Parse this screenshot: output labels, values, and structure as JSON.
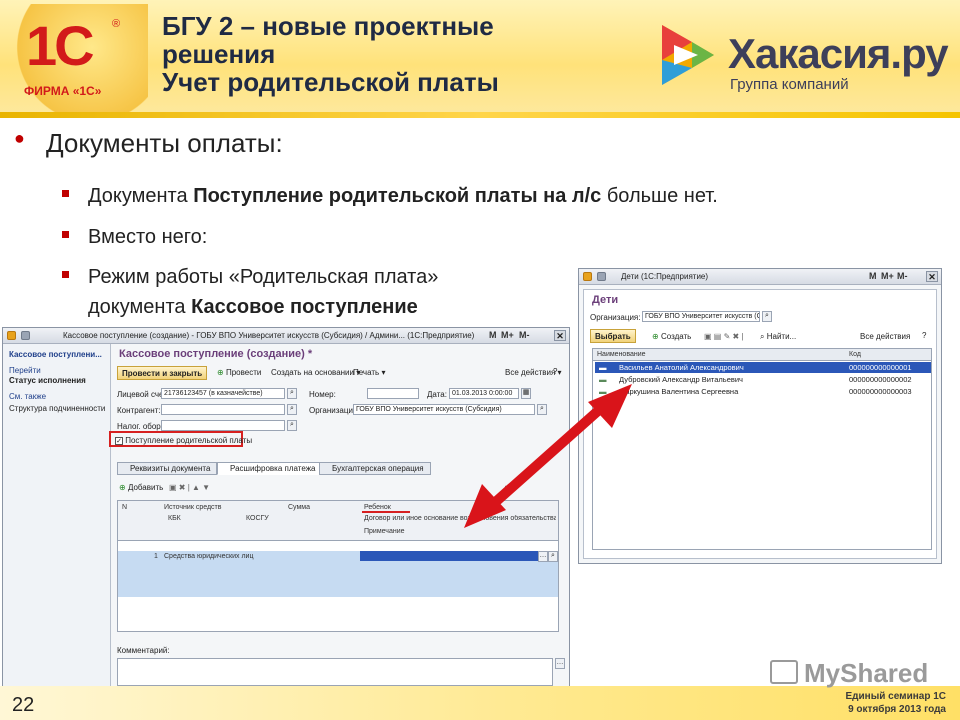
{
  "slide": {
    "title_lines": [
      "БГУ 2 – новые проектные",
      "решения",
      "Учет родительской платы"
    ],
    "logo_1c": {
      "mark": "1С",
      "reg": "®",
      "text": "ФИРМА «1С»"
    },
    "partner_logo": {
      "name": "Хакасия.ру",
      "subtitle": "Группа компаний"
    },
    "main_bullet": "Документы оплаты:",
    "sub_bullets": [
      {
        "before": "Документа ",
        "bold": "Поступление родительской платы на л/с",
        "after": " больше нет."
      },
      {
        "before": "Вместо него:",
        "bold": "",
        "after": ""
      },
      {
        "line1": "Режим работы «Родительская плата»",
        "line2_before": "документа ",
        "line2_bold": "Кассовое поступление"
      }
    ],
    "page_number": "22",
    "footer_line1": "Единый семинар 1С",
    "footer_line2": "9 октября 2013 года",
    "watermark": "MyShared"
  },
  "left_window": {
    "title": "Кассовое поступление (создание) - ГОБУ ВПО Университет искусств (Субсидия) / Админи... (1С:Предприятие)",
    "controls": [
      "M",
      "M+",
      "M-"
    ],
    "sidebar": {
      "heading": "Кассовое поступлени...",
      "items": [
        "Перейти",
        "Статус исполнения",
        "См. также",
        "Структура подчиненности"
      ]
    },
    "doc_title": "Кассовое поступление (создание) *",
    "toolbar": {
      "post_close": "Провести и закрыть",
      "post": "Провести",
      "create_based": "Создать на основании",
      "print": "Печать",
      "all_actions": "Все действия"
    },
    "fields": {
      "account_label": "Лицевой счет:",
      "account_value": "21736123457 (в казначействе)",
      "number_label": "Номер:",
      "number_value": "",
      "date_label": "Дата:",
      "date_value": "01.03.2013 0:00:00",
      "contractor_label": "Контрагент:",
      "contractor_value": "",
      "org_label": "Организация:",
      "org_value": "ГОБУ ВПО Университет искусств (Субсидия)",
      "tax_label": "Налог. обор.:",
      "tax_value": ""
    },
    "checkbox_label": "Поступление родительской платы",
    "tabs": [
      "Реквизиты документа",
      "Расшифровка платежа",
      "Бухгалтерская операция"
    ],
    "grid_toolbar": {
      "add": "Добавить"
    },
    "grid_headers": {
      "n": "N",
      "source": "Источник средств",
      "kbk": "КБК",
      "kosgu": "КОСГУ",
      "sum": "Сумма",
      "child": "Ребенок",
      "contract": "Договор или иное основание возникновения обязательства",
      "note": "Примечание"
    },
    "grid_row": {
      "n": "1",
      "source": "Средства юридических лиц"
    },
    "comment_label": "Комментарий:"
  },
  "right_window": {
    "title": "Дети (1С:Предприятие)",
    "controls": [
      "M",
      "M+",
      "M-"
    ],
    "heading": "Дети",
    "org_label": "Организация:",
    "org_value": "ГОБУ ВПО Университет искусств (С",
    "toolbar": {
      "select": "Выбрать",
      "create": "Создать",
      "find": "Найти...",
      "all_actions": "Все действия"
    },
    "columns": {
      "name": "Наименование",
      "code": "Код"
    },
    "rows": [
      {
        "name": "Васильев Анатолий Александрович",
        "code": "000000000000001"
      },
      {
        "name": "Дубровский Александр Витальевич",
        "code": "000000000000002"
      },
      {
        "name": "Маркушина Валентина Сергеевна",
        "code": "000000000000003"
      }
    ]
  },
  "colors": {
    "accent_red": "#d21a1a",
    "header_yellow": "#ffe27a",
    "selection_blue": "#2b57b8",
    "form_title": "#6b3f7a"
  }
}
